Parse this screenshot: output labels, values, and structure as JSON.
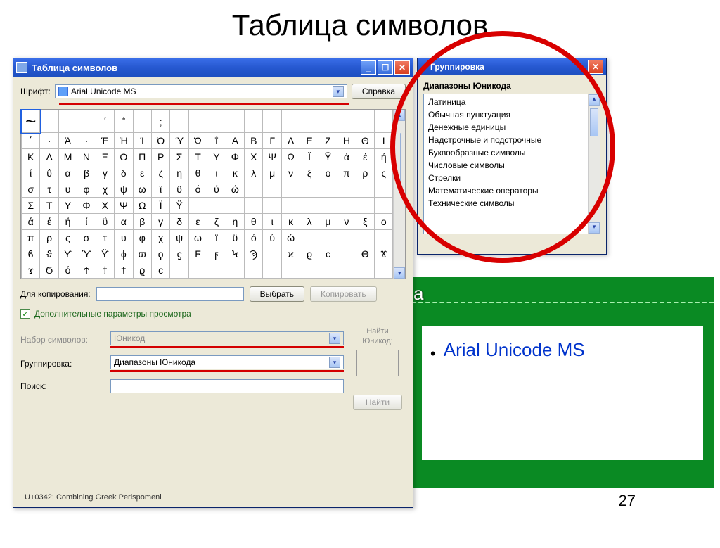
{
  "slide": {
    "title": "Таблица символов",
    "bullet_font": "Arial Unicode MS",
    "number": "27",
    "green_label": "а"
  },
  "charmap": {
    "title": "Таблица символов",
    "font_label": "Шрифт:",
    "font_value": "Arial Unicode MS",
    "help_button": "Справка",
    "grid_rows": [
      [
        "~",
        " ",
        " ",
        " ",
        "΄",
        "΅",
        "",
        ";",
        "",
        "",
        "",
        "",
        "",
        "",
        "",
        "",
        "",
        "",
        "",
        ""
      ],
      [
        "΄",
        "·",
        "Ά",
        "·",
        "Έ",
        "Ή",
        "Ί",
        "Ό",
        "Ύ",
        "Ώ",
        "ΐ",
        "Α",
        "Β",
        "Γ",
        "Δ",
        "Ε",
        "Ζ",
        "Η",
        "Θ",
        "Ι"
      ],
      [
        "Κ",
        "Λ",
        "Μ",
        "Ν",
        "Ξ",
        "Ο",
        "Π",
        "Ρ",
        "Σ",
        "Τ",
        "Υ",
        "Φ",
        "Χ",
        "Ψ",
        "Ω",
        "Ϊ",
        "Ϋ",
        "ά",
        "έ",
        "ή"
      ],
      [
        "ί",
        "ΰ",
        "α",
        "β",
        "γ",
        "δ",
        "ε",
        "ζ",
        "η",
        "θ",
        "ι",
        "κ",
        "λ",
        "μ",
        "ν",
        "ξ",
        "ο",
        "π",
        "ρ",
        "ς"
      ],
      [
        "σ",
        "τ",
        "υ",
        "φ",
        "χ",
        "ψ",
        "ω",
        "ϊ",
        "ϋ",
        "ό",
        "ύ",
        "ώ",
        "",
        "",
        "",
        "",
        "",
        "",
        "",
        ""
      ],
      [
        "Σ",
        "Τ",
        "Υ",
        "Φ",
        "Χ",
        "Ψ",
        "Ω",
        "Ϊ",
        "Ϋ",
        "",
        "",
        "",
        "",
        "",
        "",
        "",
        "",
        "",
        "",
        ""
      ],
      [
        "ά",
        "έ",
        "ή",
        "ί",
        "ΰ",
        "α",
        "β",
        "γ",
        "δ",
        "ε",
        "ζ",
        "η",
        "θ",
        "ι",
        "κ",
        "λ",
        "μ",
        "ν",
        "ξ",
        "ο"
      ],
      [
        "π",
        "ρ",
        "ς",
        "σ",
        "τ",
        "υ",
        "φ",
        "χ",
        "ψ",
        "ω",
        "ϊ",
        "ϋ",
        "ό",
        "ύ",
        "ώ",
        "",
        "",
        "",
        "",
        ""
      ],
      [
        "ϐ",
        "ϑ",
        "ϒ",
        "ϓ",
        "ϔ",
        "ϕ",
        "ϖ",
        "ϙ",
        "ϛ",
        "Ϝ",
        "ϝ",
        "Ϟ",
        "Ϡ",
        "",
        "ϰ",
        "ϱ",
        "ϲ",
        "",
        "ϴ",
        "Ϫ"
      ],
      [
        "ϫ",
        "Ϭ",
        "ό",
        "Ϯ",
        "ϯ",
        "†",
        "ϱ",
        "ϲ",
        "",
        "",
        "",
        "",
        "",
        "",
        "",
        "",
        "",
        "",
        "",
        ""
      ]
    ],
    "copy_label": "Для копирования:",
    "choose_btn": "Выбрать",
    "copy_btn": "Копировать",
    "adv_label": "Дополнительные параметры просмотра",
    "charset_label": "Набор символов:",
    "charset_value": "Юникод",
    "group_label": "Группировка:",
    "group_value": "Диапазоны Юникода",
    "find_side_label1": "Найти",
    "find_side_label2": "Юникод:",
    "search_label": "Поиск:",
    "find_btn": "Найти",
    "status": "U+0342: Combining Greek Perispomeni"
  },
  "grouping": {
    "title": "Группировка",
    "heading": "Диапазоны Юникода",
    "items": [
      "Латиница",
      "Обычная пунктуация",
      "Денежные единицы",
      "Надстрочные и подстрочные",
      "Буквообразные символы",
      "Числовые символы",
      "Стрелки",
      "Математические операторы",
      "Технические символы"
    ]
  }
}
